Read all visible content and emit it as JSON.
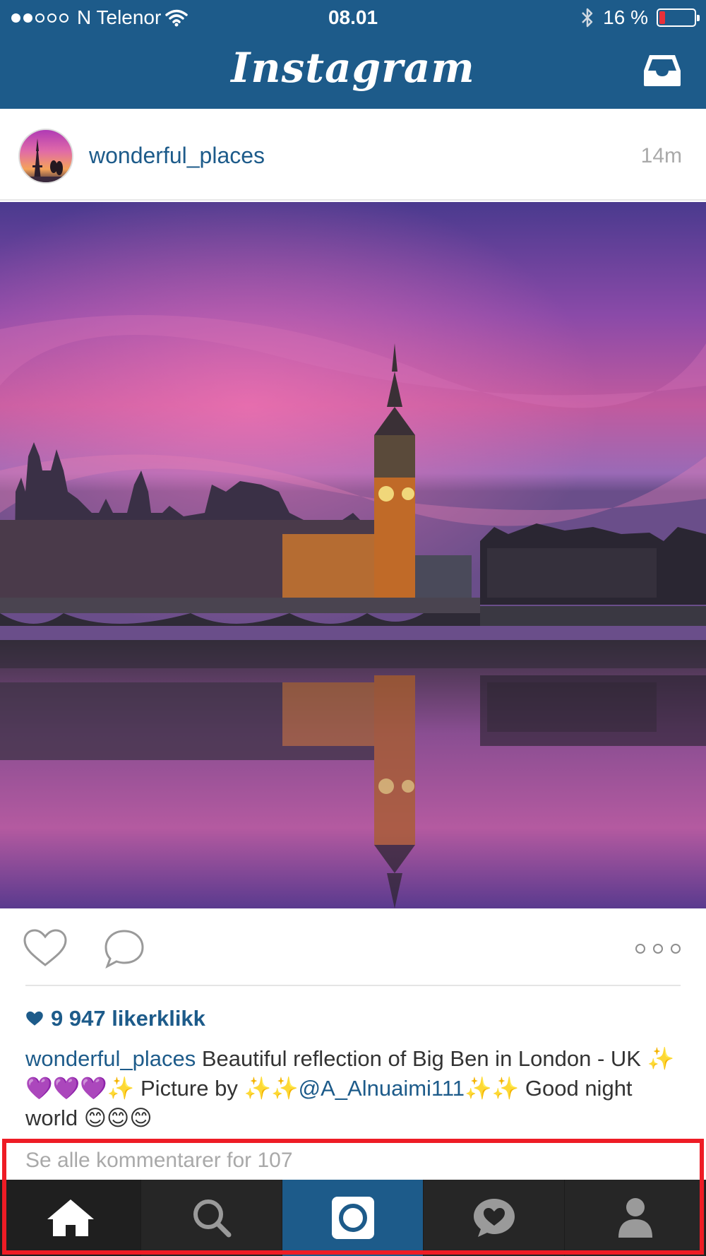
{
  "status_bar": {
    "signal_dots_filled": 2,
    "signal_dots_total": 5,
    "carrier": "N Telenor",
    "time": "08.01",
    "battery_text": "16 %",
    "battery_level": 0.16,
    "battery_color": "#e8303a"
  },
  "header": {
    "title": "Instagram",
    "background_color": "#1d5b8a",
    "inbox_icon": "inbox-tray-icon"
  },
  "post": {
    "username": "wonderful_places",
    "timestamp": "14m",
    "photo_alt": "Big Ben and Palace of Westminster at sunset reflected in the Thames",
    "actions": {
      "like_icon": "heart-outline-icon",
      "comment_icon": "speech-bubble-icon",
      "more_icon": "ellipsis-icon"
    },
    "likes": "9 947 likerklikk",
    "caption": {
      "user": "wonderful_places",
      "text_1": " Beautiful reflection of Big Ben in London - UK ✨💜💜💜✨ Picture by ✨✨",
      "mention": "@A_Alnuaimi111",
      "text_2": "✨✨ Good night world 😊😊😊"
    },
    "view_comments": "Se alle kommentarer for 107"
  },
  "tabbar": {
    "items": [
      {
        "name": "home",
        "icon": "home-icon"
      },
      {
        "name": "search",
        "icon": "search-icon"
      },
      {
        "name": "camera",
        "icon": "camera-icon"
      },
      {
        "name": "activity",
        "icon": "heart-bubble-icon"
      },
      {
        "name": "profile",
        "icon": "profile-icon"
      }
    ]
  },
  "colors": {
    "brand_blue": "#1d5b8a",
    "link_blue": "#1d5b8a",
    "highlight_red": "#ee1c25"
  }
}
